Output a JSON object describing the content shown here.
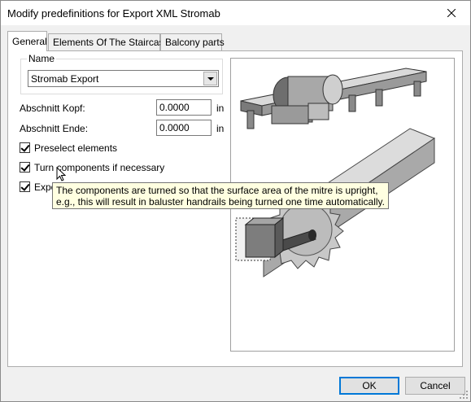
{
  "window": {
    "title": "Modify predefinitions for Export XML Stromab",
    "close_glyph": "✕"
  },
  "tabs": [
    {
      "label": "General",
      "active": true
    },
    {
      "label": "Elements Of The Staircase",
      "active": false
    },
    {
      "label": "Balcony parts",
      "active": false
    }
  ],
  "general": {
    "name_group_label": "Name",
    "name_value": "Stromab Export",
    "abschnitt_kopf_label": "Abschnitt Kopf:",
    "abschnitt_kopf_value": "0.0000",
    "abschnitt_ende_label": "Abschnitt Ende:",
    "abschnitt_ende_value": "0.0000",
    "unit": "in",
    "checkboxes": [
      {
        "label": "Preselect elements",
        "checked": true
      },
      {
        "label": "Turn components if necessary",
        "checked": true
      },
      {
        "label": "Expo",
        "checked": true
      }
    ]
  },
  "tooltip": {
    "line1": "The components are turned so that the surface area of the mitre is upright,",
    "line2": "e.g., this will result in baluster handrails being turned one time automatically."
  },
  "buttons": {
    "ok": "OK",
    "cancel": "Cancel"
  },
  "colors": {
    "tooltip_bg": "#ffffe1",
    "default_button_border": "#0078d7"
  }
}
